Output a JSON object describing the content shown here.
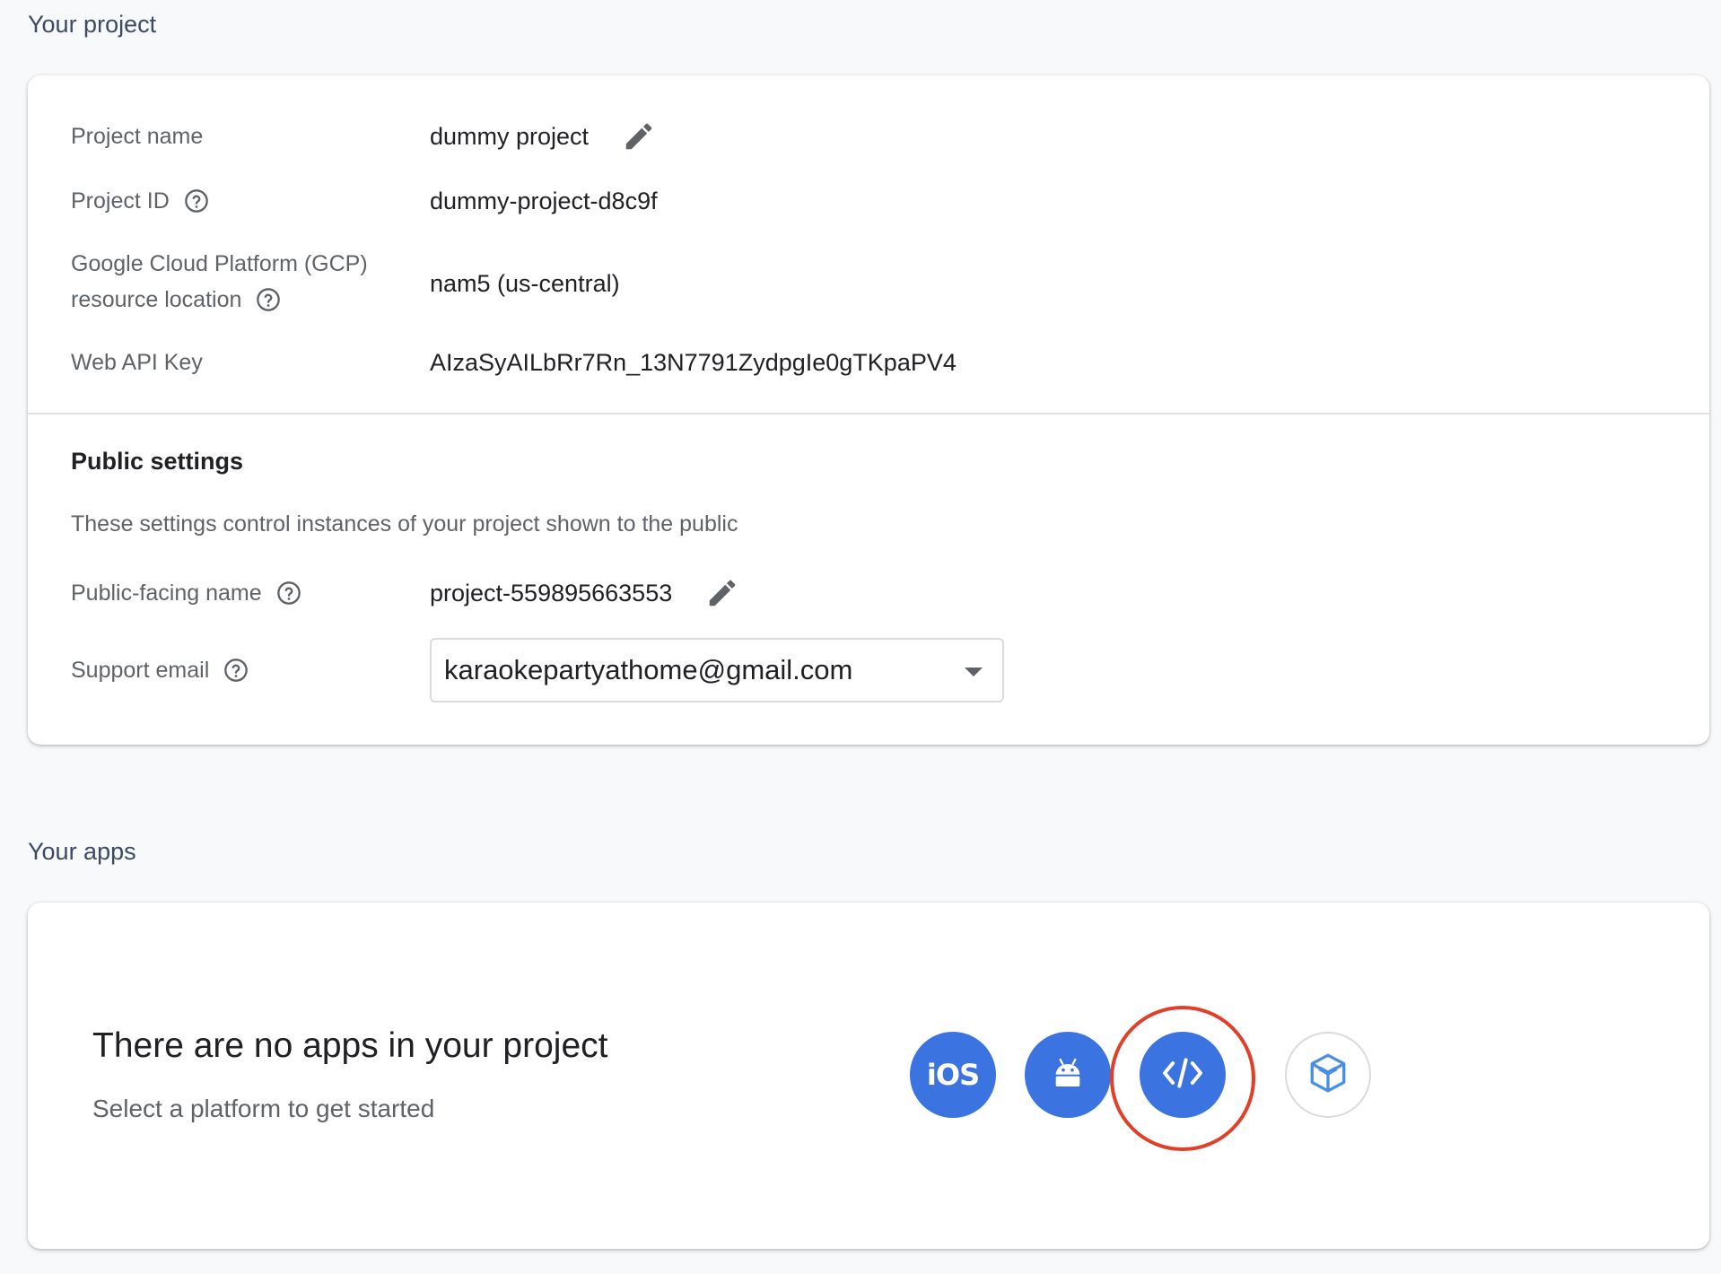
{
  "project_section": {
    "title": "Your project",
    "fields": {
      "project_name": {
        "label": "Project name",
        "value": "dummy project"
      },
      "project_id": {
        "label": "Project ID",
        "value": "dummy-project-d8c9f"
      },
      "location": {
        "label_line1": "Google Cloud Platform (GCP)",
        "label_line2": "resource location",
        "value": "nam5 (us-central)"
      },
      "api_key": {
        "label": "Web API Key",
        "value": "AIzaSyAILbRr7Rn_13N7791ZydpgIe0gTKpaPV4"
      }
    },
    "public_settings": {
      "heading": "Public settings",
      "description": "These settings control instances of your project shown to the public",
      "public_name": {
        "label": "Public-facing name",
        "value": "project-559895663553"
      },
      "support_email": {
        "label": "Support email",
        "value": "karaokepartyathome@gmail.com"
      }
    }
  },
  "apps_section": {
    "title": "Your apps",
    "empty_title": "There are no apps in your project",
    "empty_subtitle": "Select a platform to get started",
    "platforms": [
      {
        "name": "iOS",
        "label": "iOS",
        "icon": "ios-icon"
      },
      {
        "name": "Android",
        "icon": "android-icon"
      },
      {
        "name": "Web",
        "icon": "code-icon"
      },
      {
        "name": "Unity",
        "icon": "unity-icon"
      }
    ]
  },
  "colors": {
    "accent": "#3b73e1",
    "highlight": "#e0402a",
    "text": "#202124",
    "muted": "#5f6368"
  }
}
